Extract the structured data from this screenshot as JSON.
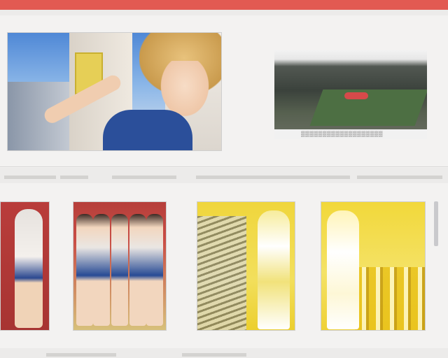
{
  "window": {
    "accent_color": "#e25a52"
  },
  "top_section": {
    "hero_illustration": "illustration-anime-girl-blue-top",
    "stadium_screenshot": {
      "image": "stadium-soccer-field",
      "caption": "▒▒▒▒▒▒▒▒▒▒▒▒▒▒▒▒▒▒▒"
    }
  },
  "breadcrumb": {
    "items": [
      "",
      "",
      "",
      "",
      ""
    ]
  },
  "gallery": {
    "subheading": "",
    "cards": [
      {
        "image": "illustration-girl-red-background"
      },
      {
        "image": "illustration-group-red-background"
      },
      {
        "image": "illustration-group-yellow-sketch"
      },
      {
        "image": "illustration-girl-yellow-crowd"
      }
    ]
  },
  "footer": {
    "items": [
      "",
      ""
    ]
  }
}
